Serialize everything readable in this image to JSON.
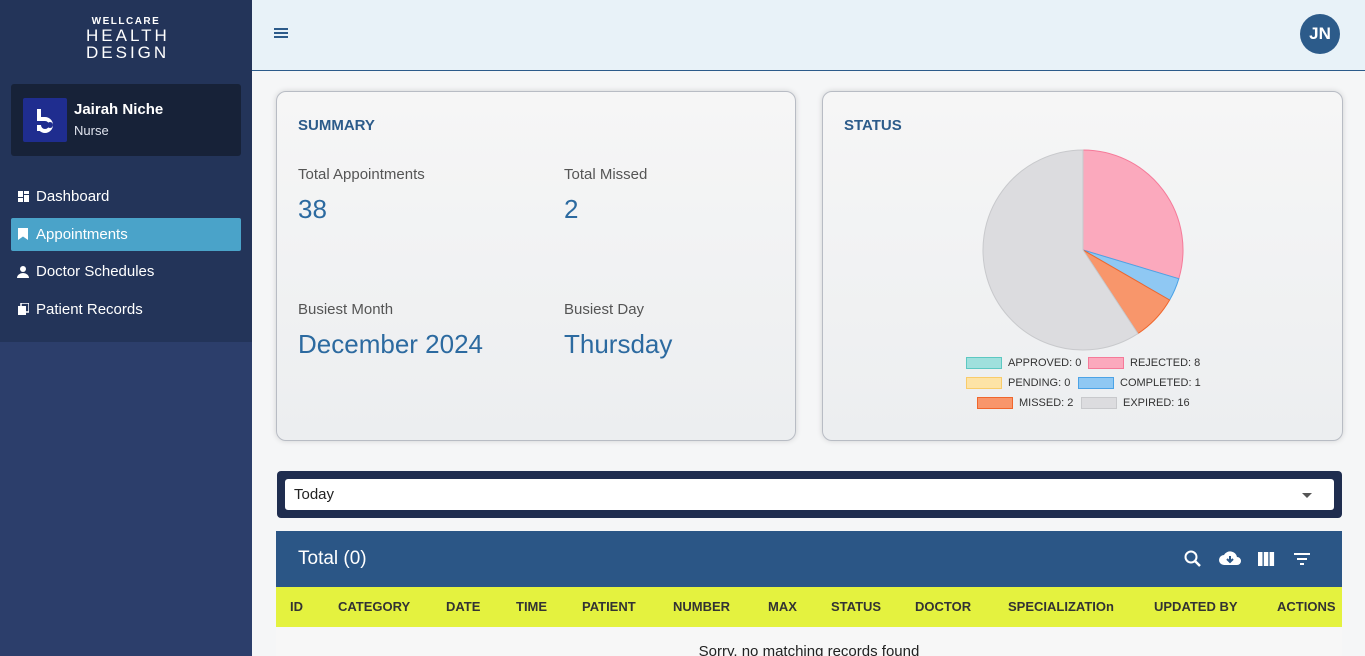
{
  "logo": {
    "brand": "WELLCARE",
    "line1": "HEALTH",
    "line2": "DESIGN"
  },
  "user": {
    "name": "Jairah Niche",
    "role": "Nurse",
    "initials": "JN"
  },
  "nav": [
    {
      "label": "Dashboard",
      "icon": "dashboard-icon"
    },
    {
      "label": "Appointments",
      "icon": "bookmark-icon",
      "active": true
    },
    {
      "label": "Doctor Schedules",
      "icon": "doctor-icon"
    },
    {
      "label": "Patient Records",
      "icon": "records-icon"
    }
  ],
  "summary": {
    "title": "SUMMARY",
    "total_appointments_label": "Total Appointments",
    "total_appointments": "38",
    "total_missed_label": "Total Missed",
    "total_missed": "2",
    "busiest_month_label": "Busiest Month",
    "busiest_month": "December 2024",
    "busiest_day_label": "Busiest Day",
    "busiest_day": "Thursday"
  },
  "status": {
    "title": "STATUS",
    "legend": [
      {
        "label": "APPROVED: 0",
        "color": "#9fe0dd",
        "border": "#5cc8c2"
      },
      {
        "label": "REJECTED: 8",
        "color": "#fba9bd",
        "border": "#f57a99"
      },
      {
        "label": "PENDING: 0",
        "color": "#fde3a6",
        "border": "#f9cc6a"
      },
      {
        "label": "COMPLETED: 1",
        "color": "#8fc8f3",
        "border": "#4ca3e6"
      },
      {
        "label": "MISSED: 2",
        "color": "#f8966b",
        "border": "#f0662c"
      },
      {
        "label": "EXPIRED: 16",
        "color": "#dcdcdf",
        "border": "#c8c9cc"
      }
    ]
  },
  "chart_data": {
    "type": "pie",
    "categories": [
      "APPROVED",
      "REJECTED",
      "PENDING",
      "COMPLETED",
      "MISSED",
      "EXPIRED"
    ],
    "values": [
      0,
      8,
      0,
      1,
      2,
      16
    ],
    "colors": [
      "#9fe0dd",
      "#fba9bd",
      "#fde3a6",
      "#8fc8f3",
      "#f8966b",
      "#dcdcdf"
    ],
    "legend_position": "bottom"
  },
  "filter": {
    "value": "Today"
  },
  "table": {
    "title": "Total (0)",
    "columns": [
      "ID",
      "CATEGORY",
      "DATE",
      "TIME",
      "PATIENT",
      "NUMBER",
      "MAX",
      "STATUS",
      "DOCTOR",
      "SPECIALIZATIOn",
      "UPDATED BY",
      "ACTIONS"
    ],
    "empty_message": "Sorry, no matching records found"
  }
}
